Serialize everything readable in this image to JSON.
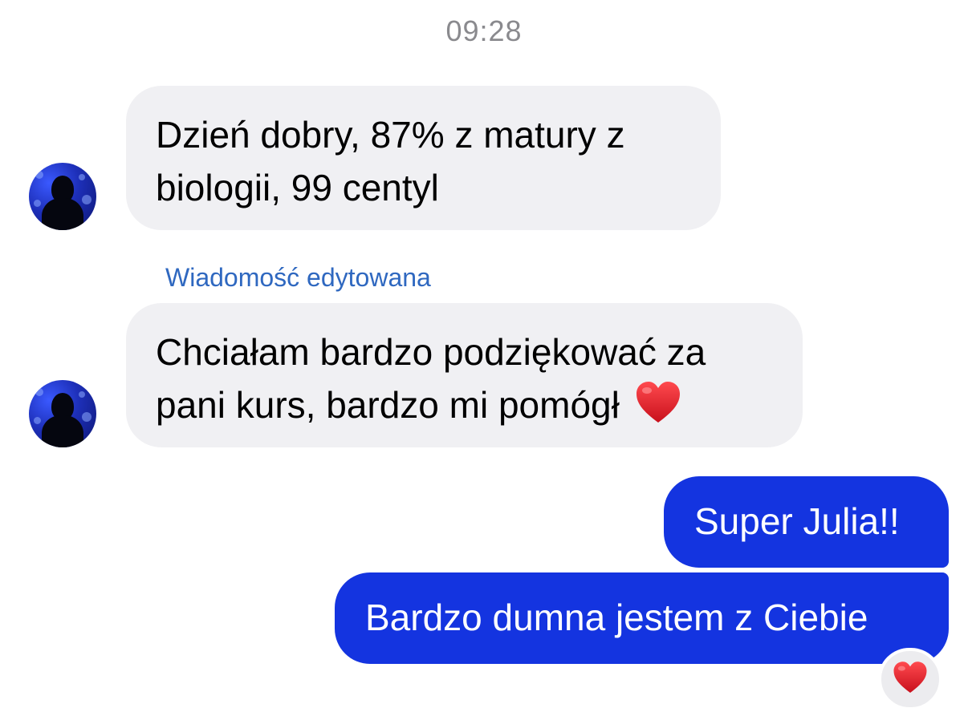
{
  "conversation": {
    "timestamp": "09:28",
    "messages": [
      {
        "direction": "incoming",
        "text": "Dzień dobry, 87% z matury z biologii, 99 centyl",
        "lines": [
          "Dzień dobry, 87% z matury z",
          "biologii, 99 centyl"
        ]
      },
      {
        "direction": "incoming",
        "edited_label": "Wiadomość edytowana",
        "text": "Chciałam bardzo podziękować za pani kurs, bardzo mi pomógł ❤️",
        "lines": [
          "Chciałam bardzo podziękować za",
          "pani kurs, bardzo mi pomógł"
        ],
        "trailing_emoji": "red-heart-icon"
      },
      {
        "direction": "outgoing",
        "text": "Super Julia!!"
      },
      {
        "direction": "outgoing",
        "text": "Bardzo dumna jestem z Ciebie",
        "reaction": "red-heart-icon"
      }
    ]
  },
  "colors": {
    "incoming_bubble": "#f0f0f3",
    "outgoing_bubble": "#1434e0",
    "edited_label": "#2f68c0",
    "timestamp": "#8a8a8e",
    "heart": "#e0202a"
  }
}
